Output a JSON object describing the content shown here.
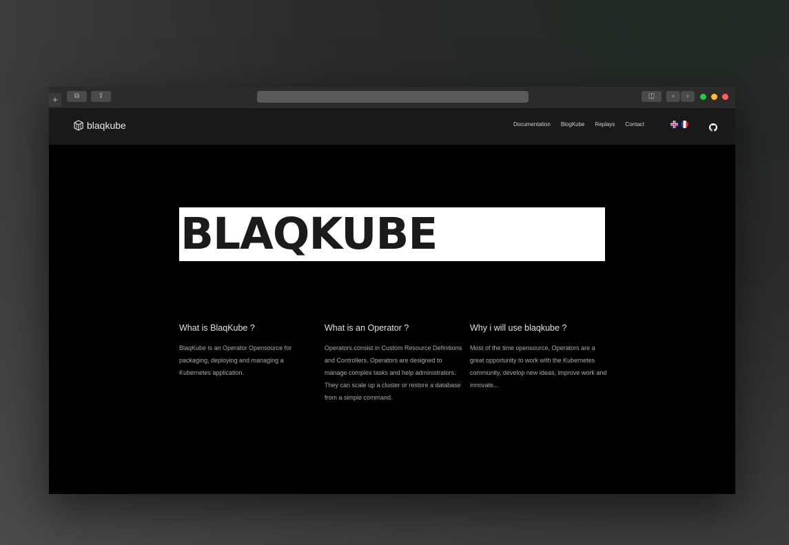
{
  "nav": {
    "logo_text": "blaqkube",
    "links": [
      "Documentation",
      "BlogKube",
      "Replays",
      "Contact"
    ]
  },
  "hero": {
    "title": "BLAQKUBE"
  },
  "features": [
    {
      "title": "What is BlaqKube ?",
      "text": "BlaqKube is an Operator Opensource for packaging, deploying and managing a Kubernetes application."
    },
    {
      "title": "What is an Operator ?",
      "text": "Operators consist in Custom Resource Definitions and Controllers. Operators are designed to manage complex tasks and help administrators. They can scale up a cluster or restore a database from a simple command."
    },
    {
      "title": "Why i will use blaqkube ?",
      "text": "Most of the time opensource, Operators are a great opportunity to work with the Kubernetes community, develop new ideas, improve work and innovate..."
    }
  ],
  "colors": {
    "page_bg": "#000000",
    "navbar_bg": "#191919",
    "hero_bg": "#ffffff",
    "hero_text": "#1b1b1b",
    "traffic_green": "#27c93f",
    "traffic_yellow": "#ffbd2e",
    "traffic_red": "#ff5f56"
  },
  "icons": [
    "tabs-icon",
    "share-icon",
    "sidebar-icon",
    "back-icon",
    "forward-icon",
    "cube-logo-icon",
    "uk-flag-icon",
    "fr-flag-icon",
    "github-icon"
  ]
}
